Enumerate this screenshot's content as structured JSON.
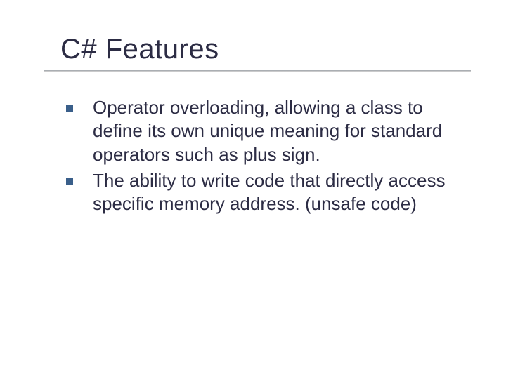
{
  "slide": {
    "title": "C# Features",
    "bullets": [
      "Operator overloading, allowing a class to define its own unique meaning for standard operators such as plus sign.",
      "The ability to write code that directly access specific memory address. (unsafe code)"
    ]
  },
  "colors": {
    "bullet_square": "#3a5f8a",
    "text": "#2c2c44"
  }
}
